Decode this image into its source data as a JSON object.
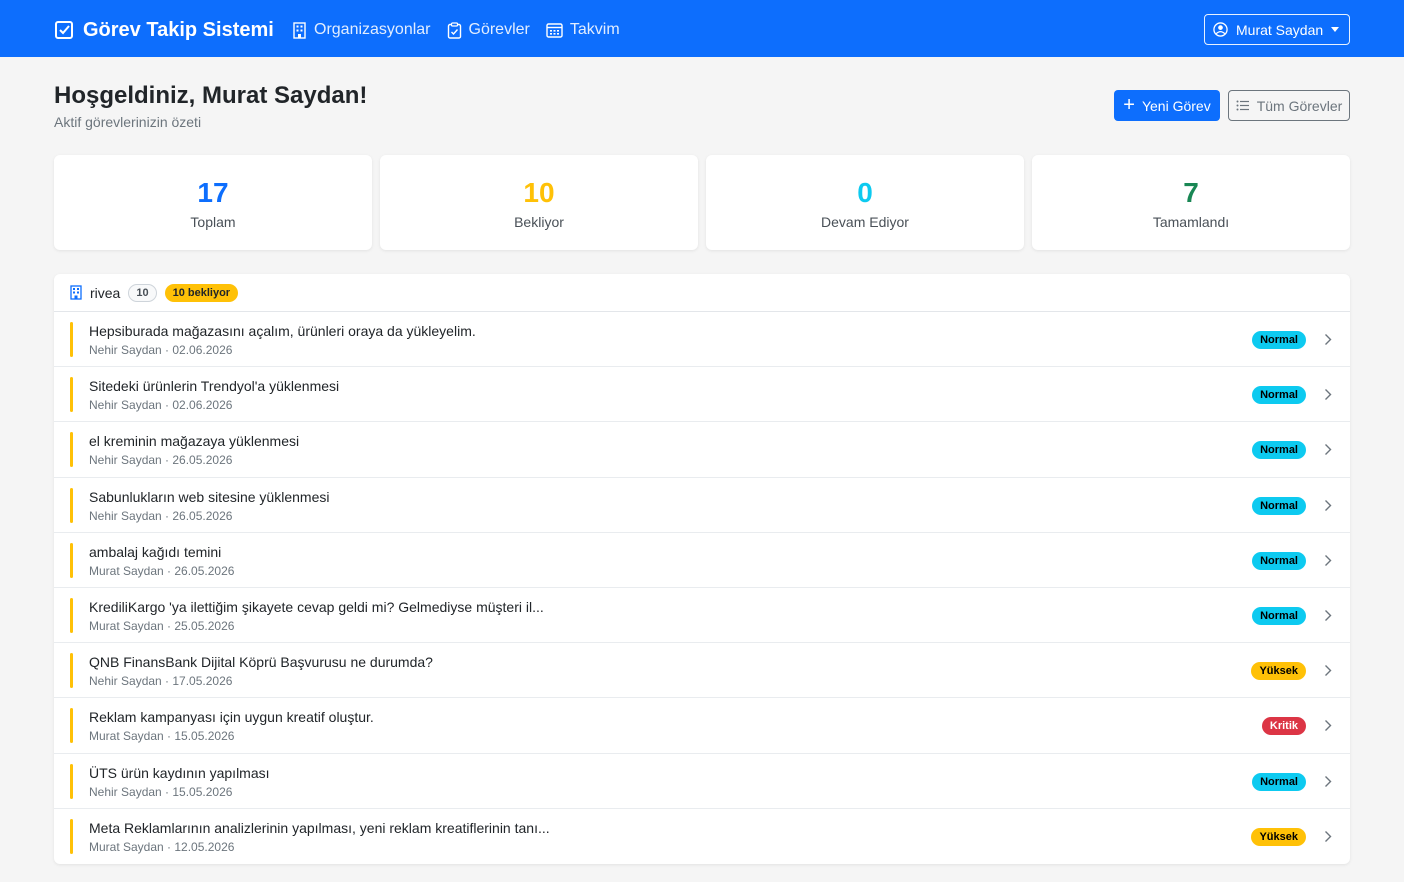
{
  "app": {
    "brand": "Görev Takip Sistemi"
  },
  "nav": [
    {
      "label": "Organizasyonlar",
      "icon": "building-icon"
    },
    {
      "label": "Görevler",
      "icon": "clipboard-check-icon"
    },
    {
      "label": "Takvim",
      "icon": "calendar-icon"
    }
  ],
  "user": {
    "name": "Murat Saydan"
  },
  "header": {
    "welcome": "Hoşgeldiniz, Murat Saydan!",
    "subtitle": "Aktif görevlerinizin özeti",
    "new_task": "Yeni Görev",
    "all_tasks": "Tüm Görevler"
  },
  "stats": [
    {
      "value": "17",
      "label": "Toplam",
      "color": "#0d6efd"
    },
    {
      "value": "10",
      "label": "Bekliyor",
      "color": "#ffc107"
    },
    {
      "value": "0",
      "label": "Devam Ediyor",
      "color": "#0dcaf0"
    },
    {
      "value": "7",
      "label": "Tamamlandı",
      "color": "#198754"
    }
  ],
  "org": {
    "name": "rivea",
    "count": "10",
    "waiting": "10 bekliyor"
  },
  "priority_colors": {
    "Normal": {
      "bg": "#0dcaf0",
      "fg": "#000000"
    },
    "Yüksek": {
      "bg": "#ffc107",
      "fg": "#000000"
    },
    "Kritik": {
      "bg": "#dc3545",
      "fg": "#ffffff"
    }
  },
  "tasks": [
    {
      "title": "Hepsiburada mağazasını açalım, ürünleri oraya da yükleyelim.",
      "meta": "Nehir Saydan · 02.06.2026",
      "priority": "Normal"
    },
    {
      "title": "Sitedeki ürünlerin Trendyol'a yüklenmesi",
      "meta": "Nehir Saydan · 02.06.2026",
      "priority": "Normal"
    },
    {
      "title": "el kreminin mağazaya yüklenmesi",
      "meta": "Nehir Saydan · 26.05.2026",
      "priority": "Normal"
    },
    {
      "title": "Sabunlukların web sitesine yüklenmesi",
      "meta": "Nehir Saydan · 26.05.2026",
      "priority": "Normal"
    },
    {
      "title": "ambalaj kağıdı temini",
      "meta": "Murat Saydan · 26.05.2026",
      "priority": "Normal"
    },
    {
      "title": "KrediliKargo 'ya ilettiğim şikayete cevap geldi mi? Gelmediyse müşteri il...",
      "meta": "Murat Saydan · 25.05.2026",
      "priority": "Normal"
    },
    {
      "title": "QNB FinansBank Dijital Köprü Başvurusu ne durumda?",
      "meta": "Nehir Saydan · 17.05.2026",
      "priority": "Yüksek"
    },
    {
      "title": "Reklam kampanyası için uygun kreatif oluştur.",
      "meta": "Murat Saydan · 15.05.2026",
      "priority": "Kritik"
    },
    {
      "title": "ÜTS ürün kaydının yapılması",
      "meta": "Nehir Saydan · 15.05.2026",
      "priority": "Normal"
    },
    {
      "title": "Meta Reklamlarının analizlerinin yapılması, yeni reklam kreatiflerinin tanı...",
      "meta": "Murat Saydan · 12.05.2026",
      "priority": "Yüksek"
    }
  ]
}
